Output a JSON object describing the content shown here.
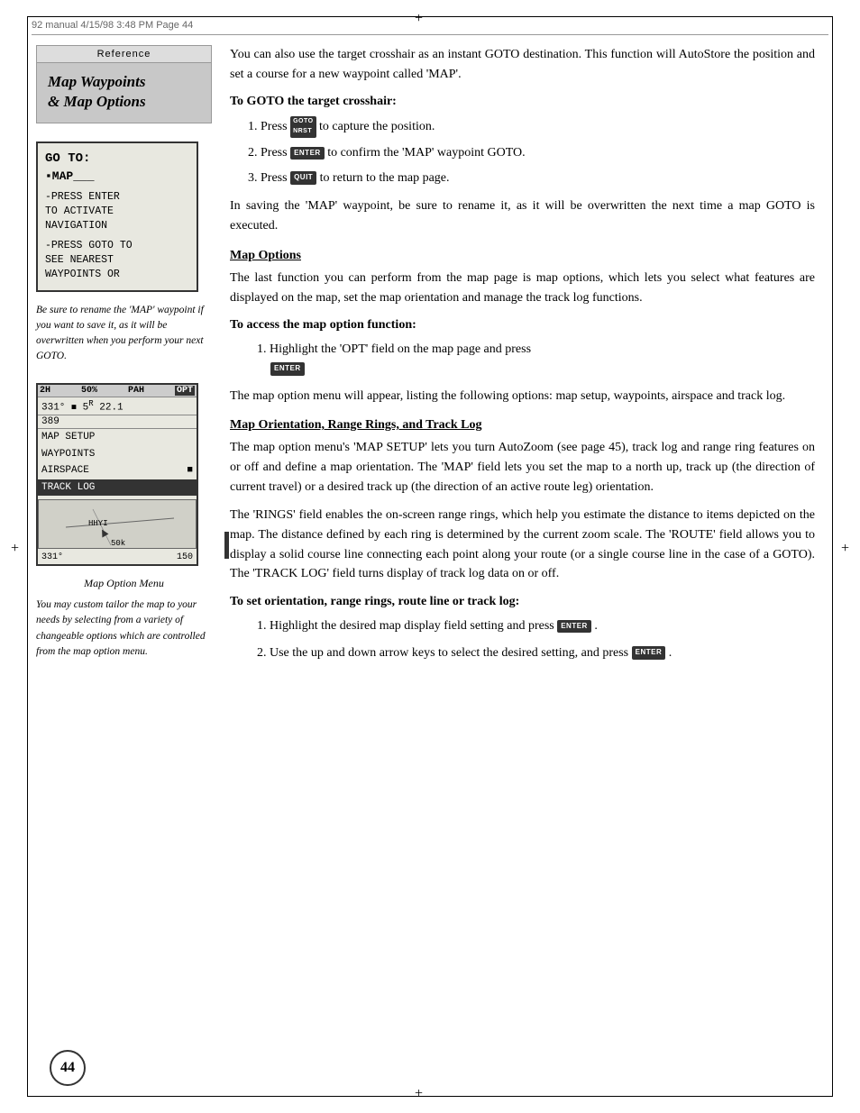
{
  "page": {
    "number": "44",
    "header_text": "92 manual   4/15/98  3:48 PM    Page 44"
  },
  "sidebar": {
    "reference_label": "Reference",
    "title_line1": "Map Waypoints",
    "title_line2": "& Map Options",
    "device_screen": {
      "goto_label": "GO TO:",
      "map_label": "▪MAP___",
      "press_enter_line1": "-PRESS ENTER",
      "press_enter_line2": "TO ACTIVATE",
      "press_enter_line3": "NAVIGATION",
      "press_goto_line1": "-PRESS GOTO TO",
      "press_goto_line2": "SEE NEAREST",
      "press_goto_line3": "WAYPOINTS OR"
    },
    "caption1": "Be sure to rename the 'MAP' waypoint if you want to save it, as it will be overwritten when you perform your next GOTO.",
    "device_screen2": {
      "header": [
        "2H",
        "50%",
        "PAH",
        "OPT"
      ],
      "data_row": "331°  =  5R 22.1",
      "data2": "389",
      "menu_items": [
        "MAP SETUP",
        "WAYPOINTS",
        "AIRSPACE",
        "TRACK LOG"
      ],
      "selected_item": "TRACK LOG",
      "waypoint": "HHYI",
      "distance": "50k",
      "bearing": "331°",
      "scale": "150"
    },
    "caption2": "Map Option Menu",
    "caption3": "You may custom tailor the map to your needs by selecting from a variety of changeable options which are controlled from the map option menu."
  },
  "main": {
    "intro_para1": "You can also use the target crosshair as an instant GOTO destination. This function will AutoStore the position and set a course for a new waypoint called 'MAP'.",
    "goto_heading": "To GOTO the target crosshair:",
    "steps_goto": [
      {
        "num": "1.",
        "text": "Press",
        "key": "GOTO NRST",
        "text2": "to capture the position."
      },
      {
        "num": "2.",
        "text": "Press",
        "key": "ENTER",
        "text2": "to confirm the 'MAP' waypoint GOTO."
      },
      {
        "num": "3.",
        "text": "Press",
        "key": "QUIT",
        "text2": "to return to the map page."
      }
    ],
    "save_para": "In saving the 'MAP' waypoint, be sure to rename it, as it will be overwritten the next time a map GOTO is executed.",
    "map_options_heading": "Map Options",
    "map_options_para": "The last function you can perform from the map page is map options, which lets you select what features are displayed on the map, set the map orientation and manage the track log functions.",
    "access_heading": "To access the map option function:",
    "access_steps": [
      {
        "num": "1.",
        "text": "Highlight the 'OPT' field on the map page and press",
        "key": "ENTER",
        "text2": ""
      }
    ],
    "access_para": "The map option menu will appear, listing the following options: map setup, waypoints, airspace and track log.",
    "orientation_heading": "Map Orientation, Range Rings, and Track Log",
    "orientation_para1": "The map option menu's 'MAP SETUP' lets you turn AutoZoom (see page 45), track log and range ring features on or off and define a map orientation. The 'MAP' field lets you set the map to a north up, track up (the direction of current travel) or a desired track up (the direction of an active route leg) orientation.",
    "orientation_para2": "The 'RINGS' field enables the on-screen range rings, which help you estimate the distance to items depicted on the map. The distance defined by each ring is determined by the current zoom scale. The 'ROUTE' field allows you to display a solid course line connecting each point along your route (or a single course line in the case of a GOTO). The 'TRACK LOG' field turns display of track log data on or off.",
    "set_heading": "To set orientation, range rings, route line or track log:",
    "set_steps": [
      {
        "num": "1.",
        "text": "Highlight the desired map display field setting and press",
        "key": "ENTER",
        "text2": "."
      },
      {
        "num": "2.",
        "text": "Use the up and down arrow keys to select the desired setting, and press",
        "key": "ENTER",
        "text2": "."
      }
    ]
  }
}
